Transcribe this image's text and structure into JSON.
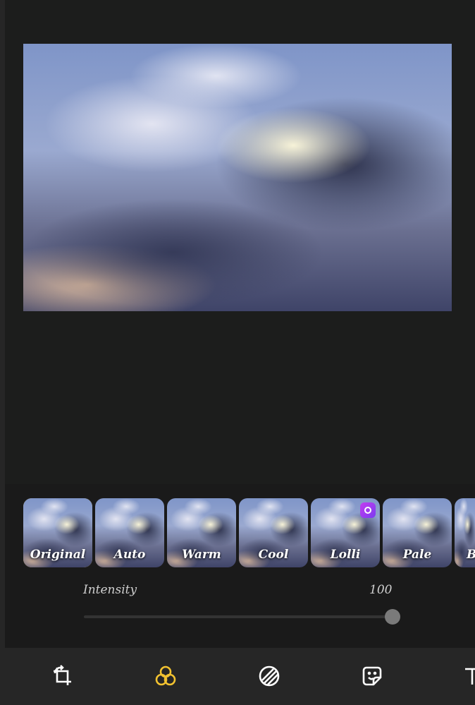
{
  "filters": [
    {
      "label": "Original",
      "selected": true,
      "premium": false
    },
    {
      "label": "Auto",
      "selected": false,
      "premium": false
    },
    {
      "label": "Warm",
      "selected": false,
      "premium": false
    },
    {
      "label": "Cool",
      "selected": false,
      "premium": false
    },
    {
      "label": "Lolli",
      "selected": false,
      "premium": true
    },
    {
      "label": "Pale",
      "selected": false,
      "premium": false
    },
    {
      "label": "B",
      "selected": false,
      "premium": false
    }
  ],
  "intensity": {
    "label": "Intensity",
    "value": "100",
    "fraction": 1.0
  },
  "toolbar": {
    "tools": [
      "crop-rotate-icon",
      "filter-icon",
      "adjust-icon",
      "sticker-icon",
      "text-icon"
    ],
    "active": "filter-icon"
  },
  "colors": {
    "accent": "#f2c230",
    "background": "#1c1d1c",
    "toolbar": "#262626"
  }
}
